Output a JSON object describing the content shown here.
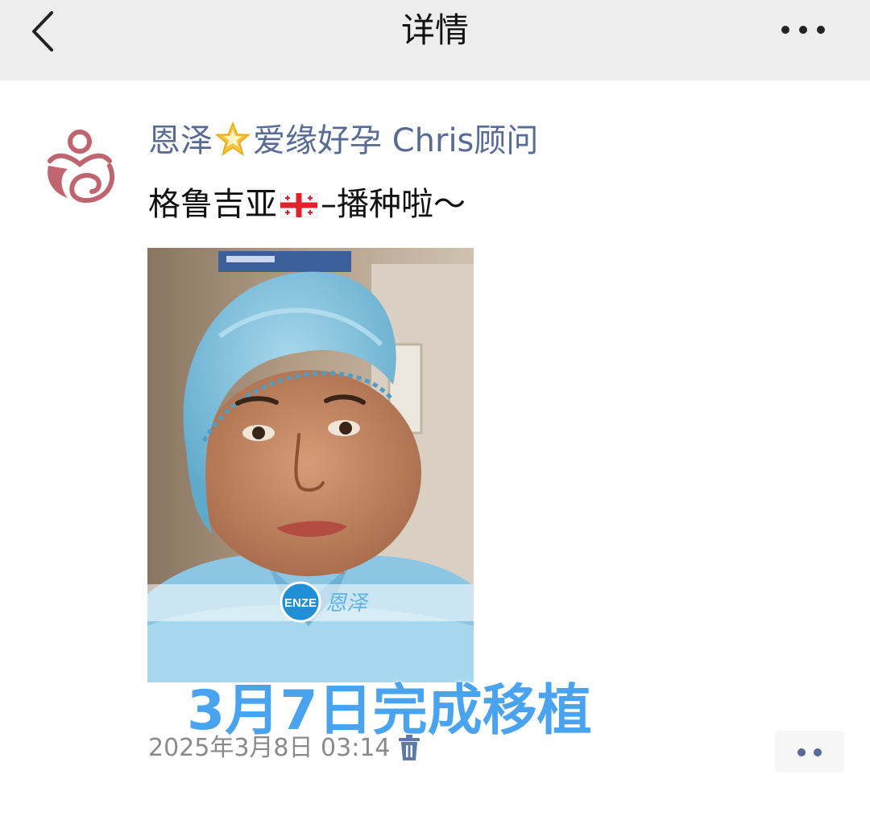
{
  "nav": {
    "title": "详情",
    "back_icon": "chevron-left-icon",
    "more_icon": "ellipsis-icon"
  },
  "post": {
    "author_name_part1": "恩泽",
    "author_badge_icon": "star-icon",
    "author_name_part2": "爱缘好孕 Chris顾问",
    "text_part1": "格鲁吉亚",
    "flag_icon": "georgia-flag-icon",
    "text_part2": "–播种啦～",
    "photo": {
      "watermark_logo": "ENZE",
      "watermark_text": "恩泽"
    },
    "overlay_caption": "3月7日完成移植",
    "timestamp": "2025年3月8日 03:14",
    "delete_icon": "trash-icon",
    "action_icon": "two-dots-icon"
  },
  "colors": {
    "link": "#576b95",
    "caption": "#4aa3ee",
    "topbar": "#ededed",
    "avatar_logo": "#c0656f"
  }
}
